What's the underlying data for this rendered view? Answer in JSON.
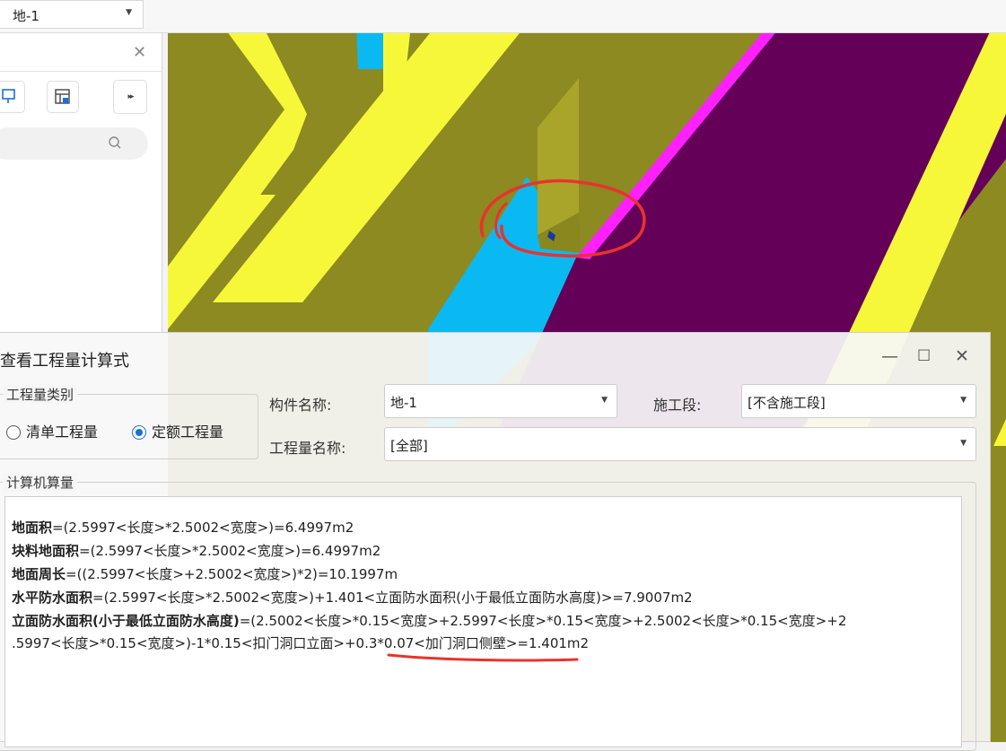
{
  "toolbar": {
    "layer_value": "地-1"
  },
  "dialog": {
    "title": "查看工程量计算式",
    "group_type_label": "工程量类别",
    "radio_list": "清单工程量",
    "radio_quota": "定额工程量",
    "selected_radio": "定额工程量",
    "component_name_label": "构件名称:",
    "component_name_value": "地-1",
    "stage_label": "施工段:",
    "stage_value": "[不含施工段]",
    "quantity_name_label": "工程量名称:",
    "quantity_name_value": "[全部]",
    "calc_group_label": "计算机算量",
    "formulas": [
      {
        "name": "地面积",
        "expr": "=(2.5997<长度>*2.5002<宽度>)=6.4997m2"
      },
      {
        "name": "块料地面积",
        "expr": "=(2.5997<长度>*2.5002<宽度>)=6.4997m2"
      },
      {
        "name": "地面周长",
        "expr": "=((2.5997<长度>+2.5002<宽度>)*2)=10.1997m"
      },
      {
        "name": "水平防水面积",
        "expr": "=(2.5997<长度>*2.5002<宽度>)+1.401<立面防水面积(小于最低立面防水高度)>=7.9007m2"
      },
      {
        "name": "立面防水面积(小于最低立面防水高度)",
        "expr": "=(2.5002<长度>*0.15<宽度>+2.5997<长度>*0.15<宽度>+2.5002<长度>*0.15<宽度>+2"
      },
      {
        "name": "",
        "expr": ".5997<长度>*0.15<宽度>)-1*0.15<扣门洞口立面>+0.3*0.07<加门洞口侧壁>=1.401m2"
      }
    ]
  },
  "colors": {
    "olive": "#8c8a20",
    "yellow": "#f7f73a",
    "purple": "#650059",
    "magenta": "#ff20ff",
    "cyan": "#0bb9f2",
    "annotation_red": "#e8332e"
  }
}
